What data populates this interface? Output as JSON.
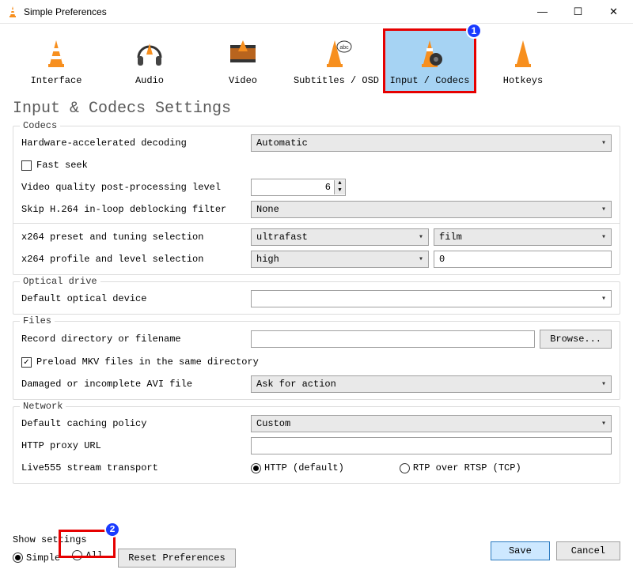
{
  "window": {
    "title": "Simple Preferences"
  },
  "tabs": [
    {
      "label": "Interface",
      "icon": "cone"
    },
    {
      "label": "Audio",
      "icon": "headphones"
    },
    {
      "label": "Video",
      "icon": "film"
    },
    {
      "label": "Subtitles / OSD",
      "icon": "cone-bubble"
    },
    {
      "label": "Input / Codecs",
      "icon": "cone-reel",
      "selected": true,
      "badge": "1"
    },
    {
      "label": "Hotkeys",
      "icon": "cone-key"
    }
  ],
  "heading": "Input & Codecs Settings",
  "groups": {
    "codecs": {
      "title": "Codecs",
      "hw_decode_label": "Hardware-accelerated decoding",
      "hw_decode_value": "Automatic",
      "fast_seek_label": "Fast seek",
      "fast_seek_checked": false,
      "vq_label": "Video quality post-processing level",
      "vq_value": "6",
      "skip_label": "Skip H.264 in-loop deblocking filter",
      "skip_value": "None",
      "x264_preset_label": "x264 preset and tuning selection",
      "x264_preset_value": "ultrafast",
      "x264_tune_value": "film",
      "x264_profile_label": "x264 profile and level selection",
      "x264_profile_value": "high",
      "x264_level_value": "0"
    },
    "optical": {
      "title": "Optical drive",
      "device_label": "Default optical device",
      "device_value": ""
    },
    "files": {
      "title": "Files",
      "record_label": "Record directory or filename",
      "record_value": "",
      "browse_label": "Browse...",
      "preload_label": "Preload MKV files in the same directory",
      "preload_checked": true,
      "avi_label": "Damaged or incomplete AVI file",
      "avi_value": "Ask for action"
    },
    "network": {
      "title": "Network",
      "cache_label": "Default caching policy",
      "cache_value": "Custom",
      "proxy_label": "HTTP proxy URL",
      "proxy_value": "",
      "stream_label": "Live555 stream transport",
      "stream_http": "HTTP (default)",
      "stream_rtp": "RTP over RTSP (TCP)"
    }
  },
  "footer": {
    "show_settings_label": "Show settings",
    "simple_label": "Simple",
    "all_label": "All",
    "all_badge": "2",
    "reset_label": "Reset Preferences",
    "save_label": "Save",
    "cancel_label": "Cancel"
  }
}
